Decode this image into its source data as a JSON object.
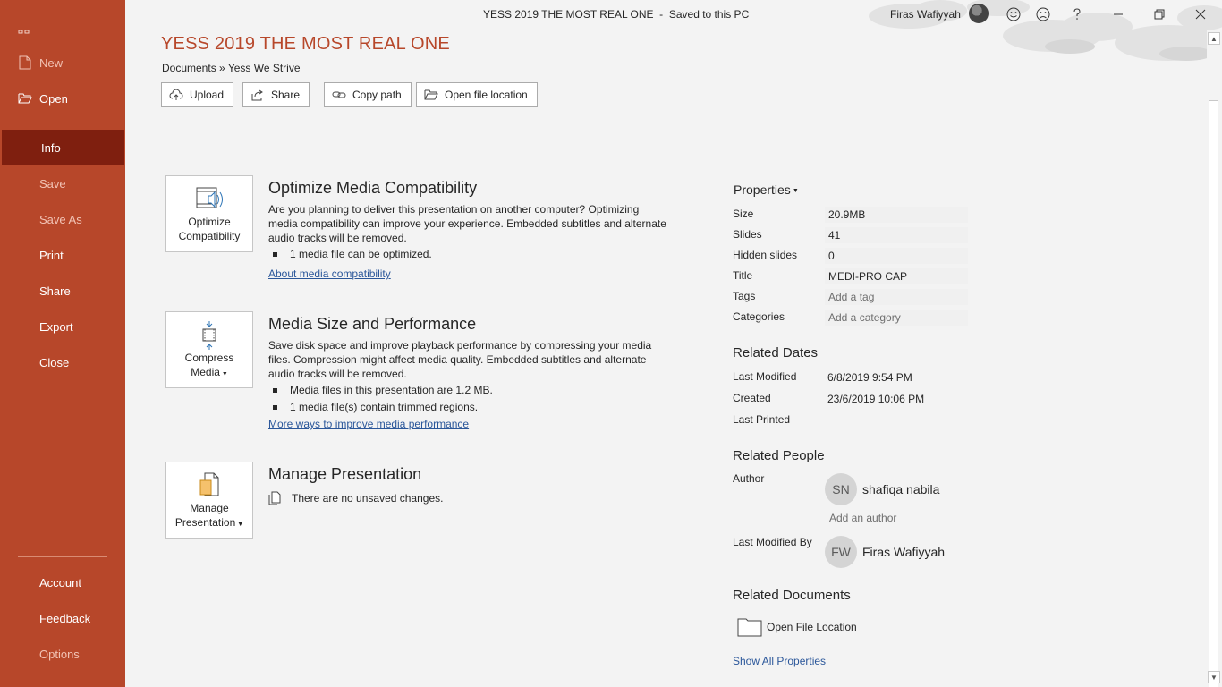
{
  "window": {
    "title": "YESS 2019 THE MOST REAL ONE  -  Saved to this PC",
    "user_name": "Firas Wafiyyah"
  },
  "sidebar": {
    "items": [
      {
        "label": "New",
        "icon": "new-document-icon"
      },
      {
        "label": "Open",
        "icon": "open-folder-icon"
      },
      {
        "label": "Info"
      },
      {
        "label": "Save"
      },
      {
        "label": "Save As"
      },
      {
        "label": "Print"
      },
      {
        "label": "Share"
      },
      {
        "label": "Export"
      },
      {
        "label": "Close"
      },
      {
        "label": "Account"
      },
      {
        "label": "Feedback"
      },
      {
        "label": "Options"
      }
    ]
  },
  "header": {
    "doc_title": "YESS 2019 THE MOST REAL ONE",
    "breadcrumb": "Documents » Yess We Strive",
    "actions": {
      "upload": "Upload",
      "share": "Share",
      "copy_path": "Copy path",
      "open_location": "Open file location"
    }
  },
  "sections": {
    "optimize": {
      "button": [
        "Optimize",
        "Compatibility"
      ],
      "title": "Optimize Media Compatibility",
      "desc": "Are you planning to deliver this presentation on another computer? Optimizing media compatibility can improve your experience. Embedded subtitles and alternate audio tracks will be removed.",
      "bullets": [
        "1 media file can be optimized."
      ],
      "link": "About media compatibility"
    },
    "compress": {
      "button": [
        "Compress",
        "Media"
      ],
      "title": "Media Size and Performance",
      "desc": "Save disk space and improve playback performance by compressing your media files. Compression might affect media quality. Embedded subtitles and alternate audio tracks will be removed.",
      "bullets": [
        "Media files in this presentation are 1.2 MB.",
        "1 media file(s) contain trimmed regions."
      ],
      "link": "More ways to improve media performance"
    },
    "manage": {
      "button": [
        "Manage",
        "Presentation"
      ],
      "title": "Manage Presentation",
      "status": "There are no unsaved changes."
    }
  },
  "properties": {
    "heading": "Properties",
    "size": {
      "label": "Size",
      "value": "20.9MB"
    },
    "slides": {
      "label": "Slides",
      "value": "41"
    },
    "hidden": {
      "label": "Hidden slides",
      "value": "0"
    },
    "title": {
      "label": "Title",
      "value": "MEDI-PRO CAP"
    },
    "tags": {
      "label": "Tags",
      "placeholder": "Add a tag"
    },
    "categories": {
      "label": "Categories",
      "placeholder": "Add a category"
    }
  },
  "related_dates": {
    "heading": "Related Dates",
    "last_modified": {
      "label": "Last Modified",
      "value": "6/8/2019 9:54 PM"
    },
    "created": {
      "label": "Created",
      "value": "23/6/2019 10:06 PM"
    },
    "last_printed": {
      "label": "Last Printed",
      "value": ""
    }
  },
  "related_people": {
    "heading": "Related People",
    "author_label": "Author",
    "author": {
      "initials": "SN",
      "name": "shafiqa nabila"
    },
    "add_author": "Add an author",
    "modified_by_label": "Last Modified By",
    "modified_by": {
      "initials": "FW",
      "name": "Firas Wafiyyah"
    }
  },
  "related_documents": {
    "heading": "Related Documents",
    "open_location": "Open File Location",
    "show_all": "Show All Properties"
  },
  "colors": {
    "accent": "#b7472a",
    "active_nav": "#7f1f0f",
    "link": "#2b579a"
  }
}
